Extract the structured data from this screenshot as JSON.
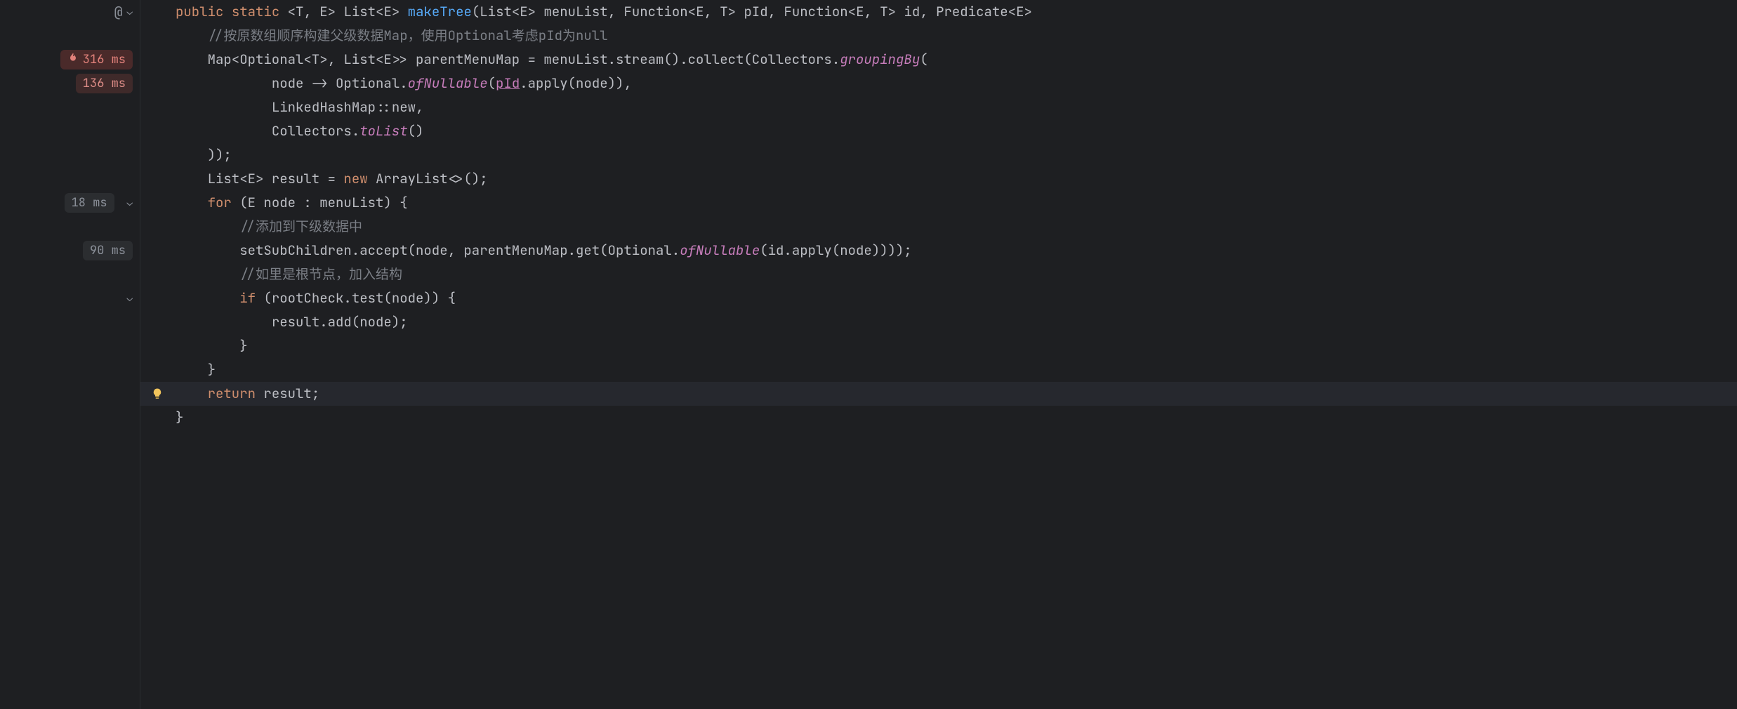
{
  "gutter": {
    "at_label": "@",
    "badges": {
      "hot": "316 ms",
      "med": "136 ms",
      "low1": "18 ms",
      "low2": "90 ms"
    }
  },
  "icons": {
    "flame": "🔥",
    "bulb": "💡",
    "chevron_down": "⌄"
  },
  "code": {
    "l0": {
      "kw_public": "public",
      "kw_static": "static",
      "generics": "<T, E>",
      "ret_type_a": "List<",
      "ret_type_b": "E",
      "ret_type_c": ">",
      "fn_name": "makeTree",
      "params": "(List<E> menuList, Function<E, T> pId, Function<E, T> id, Predicate<E>"
    },
    "l1": {
      "cmt": "//按原数组顺序构建父级数据Map，使用Optional考虑pId为null"
    },
    "l2": {
      "a": "Map<Optional<T>, List<E>> parentMenuMap = menuList.stream().collect(Collectors.",
      "grp": "groupingBy",
      "b": "("
    },
    "l3": {
      "a": "node -> Optional.",
      "ofn": "ofNullable",
      "b": "(",
      "pid": "pId",
      "c": ".apply(node)),"
    },
    "l4": {
      "a": "LinkedHashMap::new,"
    },
    "l5": {
      "a": "Collectors.",
      "tol": "toList",
      "b": "()"
    },
    "l6": {
      "a": "));"
    },
    "l7": {
      "a": "List<E> result = ",
      "knew": "new",
      "b": " ArrayList<>();"
    },
    "l8": {
      "kfor": "for",
      "a": " (E node : menuList) {"
    },
    "l9": {
      "cmt": "//添加到下级数据中"
    },
    "l10": {
      "a": "setSubChildren.accept(node, parentMenuMap.get(Optional.",
      "ofn": "ofNullable",
      "b": "(id.apply(node))));"
    },
    "l11": {
      "cmt": "//如里是根节点，加入结构"
    },
    "l12": {
      "kif": "if",
      "a": " (rootCheck.test(node)) {"
    },
    "l13": {
      "a": "result.add(node);"
    },
    "l14": {
      "a": "}"
    },
    "l15": {
      "a": "}"
    },
    "l16": {
      "kret": "return",
      "a": " result;"
    },
    "l17": {
      "a": "}"
    }
  }
}
